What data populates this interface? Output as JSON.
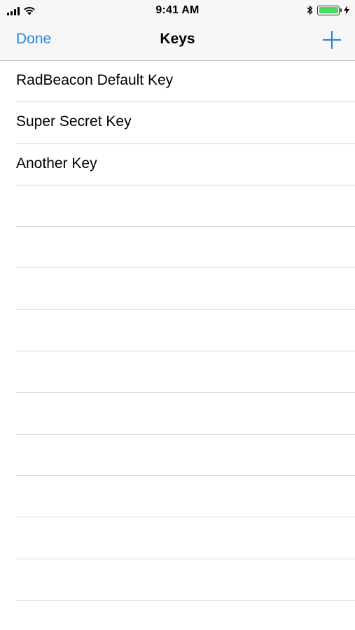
{
  "status_bar": {
    "time": "9:41 AM",
    "battery_color": "#4cd964",
    "icons": [
      "signal-icon",
      "wifi-icon",
      "bluetooth-icon",
      "battery-icon",
      "charging-icon"
    ]
  },
  "nav_bar": {
    "done_label": "Done",
    "title": "Keys",
    "add_icon": "plus-icon",
    "accent_color": "#2a87d7"
  },
  "keys": [
    {
      "label": "RadBeacon Default Key"
    },
    {
      "label": "Super Secret Key"
    },
    {
      "label": "Another Key"
    }
  ]
}
